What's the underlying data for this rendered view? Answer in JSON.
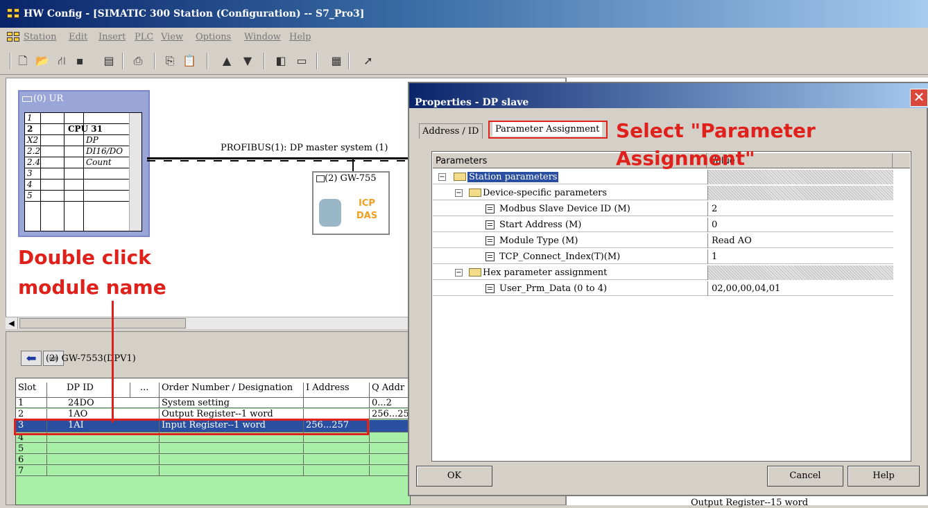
{
  "window": {
    "title": "HW Config - [SIMATIC 300 Station (Configuration) -- S7_Pro3]"
  },
  "menu": [
    "Station",
    "Edit",
    "Insert",
    "PLC",
    "View",
    "Options",
    "Window",
    "Help"
  ],
  "toolbar": [
    "new-icon",
    "open-icon",
    "network-icon",
    "save-icon",
    "download-icon",
    "print-icon",
    "copy-icon",
    "paste-icon",
    "upload-icon",
    "download-station-icon",
    "catalog-icon",
    "view-icon",
    "properties-icon",
    "help-icon"
  ],
  "rack": {
    "title": "(0) UR",
    "rows": [
      {
        "slot": "1",
        "module": ""
      },
      {
        "slot": "2",
        "module": "CPU 31"
      },
      {
        "slot": "X2",
        "module": "DP"
      },
      {
        "slot": "2.2",
        "module": "DI16/DO"
      },
      {
        "slot": "2.4",
        "module": "Count"
      },
      {
        "slot": "3",
        "module": ""
      },
      {
        "slot": "4",
        "module": ""
      },
      {
        "slot": "5",
        "module": ""
      }
    ]
  },
  "profibus": {
    "label": "PROFIBUS(1): DP master system (1)"
  },
  "gateway": {
    "label": "(2) GW-755",
    "logo": "ICP DAS"
  },
  "annotations": {
    "double_click": "Double click",
    "module_name": "module name",
    "select_param_1": "Select \"Parameter",
    "select_param_2": "Assignment\""
  },
  "detail": {
    "title": "(2)   GW-7553(DPV1)",
    "columns": [
      "Slot",
      "DP ID",
      "...",
      "Order Number / Designation",
      "I Address",
      "Q Addr"
    ],
    "rows": [
      {
        "slot": "1",
        "dpid": "24DO",
        "designation": "System setting",
        "iaddr": "",
        "qaddr": "0...2"
      },
      {
        "slot": "2",
        "dpid": "1AO",
        "designation": "Output Register--1 word",
        "iaddr": "",
        "qaddr": "256...25"
      },
      {
        "slot": "3",
        "dpid": "1AI",
        "designation": "Input Register--1 word",
        "iaddr": "256...257",
        "qaddr": ""
      },
      {
        "slot": "4",
        "dpid": "",
        "designation": "",
        "iaddr": "",
        "qaddr": ""
      },
      {
        "slot": "5",
        "dpid": "",
        "designation": "",
        "iaddr": "",
        "qaddr": ""
      },
      {
        "slot": "6",
        "dpid": "",
        "designation": "",
        "iaddr": "",
        "qaddr": ""
      },
      {
        "slot": "7",
        "dpid": "",
        "designation": "",
        "iaddr": "",
        "qaddr": ""
      }
    ],
    "catalog_peek": "Output Register--15 word"
  },
  "dialog": {
    "title": "Properties - DP slave",
    "tabs": [
      "Address / ID",
      "Parameter Assignment"
    ],
    "columns": [
      "Parameters",
      "Value"
    ],
    "rows": [
      {
        "name": "Station parameters",
        "value": ""
      },
      {
        "name": "Device-specific parameters",
        "value": ""
      },
      {
        "name": "Modbus Slave Device ID (M)",
        "value": "2"
      },
      {
        "name": "Start Address (M)",
        "value": "0"
      },
      {
        "name": "Module Type (M)",
        "value": "Read AO"
      },
      {
        "name": "TCP_Connect_Index(T)(M)",
        "value": "1"
      },
      {
        "name": "Hex parameter assignment",
        "value": ""
      },
      {
        "name": "User_Prm_Data (0 to 4)",
        "value": "02,00,00,04,01"
      }
    ],
    "buttons": {
      "ok": "OK",
      "cancel": "Cancel",
      "help": "Help"
    }
  }
}
